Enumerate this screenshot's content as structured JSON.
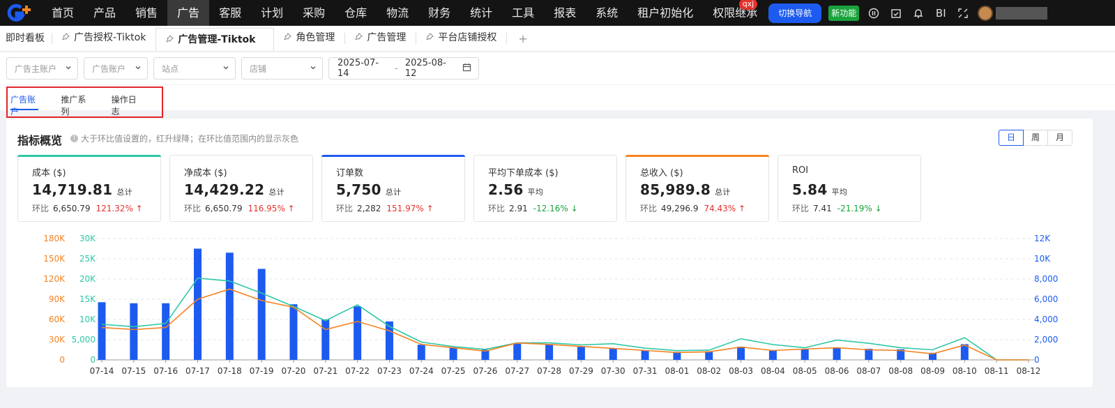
{
  "nav": {
    "items": [
      "首页",
      "产品",
      "销售",
      "广告",
      "客服",
      "计划",
      "采购",
      "仓库",
      "物流",
      "财务",
      "统计",
      "工具",
      "报表",
      "系统",
      "租户初始化",
      "权限继承"
    ],
    "active_index": 3,
    "badge": "qxj",
    "switch_label": "切换导航",
    "new_label": "新功能",
    "bi_label": "BI"
  },
  "tabs": {
    "first": "即时看板",
    "items": [
      "广告授权-Tiktok",
      "广告管理-Tiktok",
      "角色管理",
      "广告管理",
      "平台店铺授权"
    ],
    "active_index": 1,
    "add": "+"
  },
  "filters": {
    "ad_owner": "广告主账户",
    "ad_account": "广告账户",
    "site": "站点",
    "shop": "店铺",
    "date_start": "2025-07-14",
    "date_sep": "-",
    "date_end": "2025-08-12"
  },
  "subtabs": [
    "广告账户",
    "推广系列",
    "操作日志"
  ],
  "overview": {
    "title": "指标概览",
    "hint": "大于环比值设置的，红升绿降；在环比值范围内的显示灰色",
    "periods": [
      "日",
      "周",
      "月"
    ],
    "active_period": 0
  },
  "metrics": [
    {
      "label": "成本 ($)",
      "value": "14,719.81",
      "suffix": "总计",
      "cmp_label": "环比",
      "cmp_value": "6,650.79",
      "pct": "121.32%",
      "dir": "up",
      "color": "#2ec7a5"
    },
    {
      "label": "净成本 ($)",
      "value": "14,429.22",
      "suffix": "总计",
      "cmp_label": "环比",
      "cmp_value": "6,650.79",
      "pct": "116.95%",
      "dir": "up",
      "color": ""
    },
    {
      "label": "订单数",
      "value": "5,750",
      "suffix": "总计",
      "cmp_label": "环比",
      "cmp_value": "2,282",
      "pct": "151.97%",
      "dir": "up",
      "color": "#1d5bf0"
    },
    {
      "label": "平均下单成本 ($)",
      "value": "2.56",
      "suffix": "平均",
      "cmp_label": "环比",
      "cmp_value": "2.91",
      "pct": "-12.16%",
      "dir": "down",
      "color": ""
    },
    {
      "label": "总收入 ($)",
      "value": "85,989.8",
      "suffix": "总计",
      "cmp_label": "环比",
      "cmp_value": "49,296.9",
      "pct": "74.43%",
      "dir": "up",
      "color": "#f5821f"
    },
    {
      "label": "ROI",
      "value": "5.84",
      "suffix": "平均",
      "cmp_label": "环比",
      "cmp_value": "7.41",
      "pct": "-21.19%",
      "dir": "down",
      "color": ""
    }
  ],
  "chart_data": {
    "type": "bar",
    "categories": [
      "07-14",
      "07-15",
      "07-16",
      "07-17",
      "07-18",
      "07-19",
      "07-20",
      "07-21",
      "07-22",
      "07-23",
      "07-24",
      "07-25",
      "07-26",
      "07-27",
      "07-28",
      "07-29",
      "07-30",
      "07-31",
      "08-01",
      "08-02",
      "08-03",
      "08-04",
      "08-05",
      "08-06",
      "08-07",
      "08-08",
      "08-09",
      "08-10",
      "08-11",
      "08-12"
    ],
    "series": [
      {
        "name": "",
        "kind": "bar",
        "axis": "right",
        "color": "#1d5bf0",
        "values": [
          5700,
          5600,
          5600,
          11000,
          10600,
          9000,
          5500,
          4000,
          5300,
          3800,
          1500,
          1200,
          1000,
          1600,
          1500,
          1300,
          1100,
          950,
          800,
          850,
          1300,
          900,
          1100,
          1150,
          1100,
          1050,
          700,
          1550,
          0,
          0
        ]
      },
      {
        "name": "",
        "kind": "line",
        "axis": "left2",
        "color": "#2ec7a5",
        "values": [
          8800,
          8200,
          9000,
          20200,
          19500,
          16500,
          13200,
          9700,
          13600,
          8300,
          4400,
          3300,
          2600,
          4200,
          4200,
          3700,
          4000,
          2900,
          2300,
          2400,
          5200,
          3800,
          3000,
          4900,
          4100,
          3000,
          2500,
          5500,
          0,
          0
        ]
      },
      {
        "name": "",
        "kind": "line",
        "axis": "left1",
        "color": "#f5821f",
        "values": [
          48000,
          45000,
          48000,
          90000,
          105000,
          88000,
          78000,
          45000,
          57000,
          43000,
          23000,
          18000,
          13000,
          25000,
          23000,
          20000,
          17000,
          14000,
          11000,
          12000,
          19000,
          14000,
          16000,
          18000,
          15000,
          14000,
          9000,
          22000,
          0,
          0
        ]
      }
    ],
    "left1_ticks": [
      "0",
      "30K",
      "60K",
      "90K",
      "120K",
      "150K",
      "180K"
    ],
    "left1_ylim": [
      0,
      180000
    ],
    "left2_ticks": [
      "0",
      "5,000",
      "10K",
      "15K",
      "20K",
      "25K",
      "30K"
    ],
    "left2_ylim": [
      0,
      30000
    ],
    "right_ticks": [
      "0",
      "2,000",
      "4,000",
      "6,000",
      "8,000",
      "10K",
      "12K"
    ],
    "right_ylim": [
      0,
      12000
    ],
    "colors": {
      "left1": "#f5821f",
      "left2": "#2ec7a5",
      "right": "#1d5bf0"
    }
  }
}
